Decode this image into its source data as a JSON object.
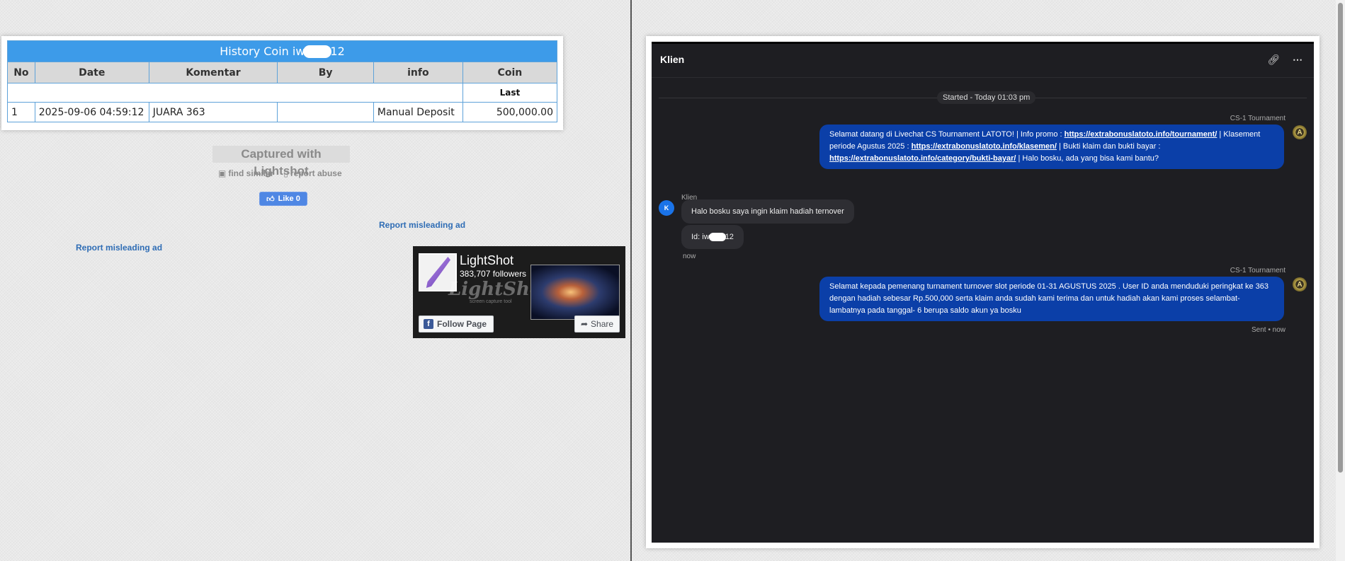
{
  "history": {
    "title_prefix": "History Coin iw",
    "title_suffix": "12",
    "columns": [
      "No",
      "Date",
      "Komentar",
      "By",
      "info",
      "Coin"
    ],
    "last_label": "Last",
    "rows": [
      {
        "no": "1",
        "date": "2025-09-06 04:59:12",
        "komentar": "JUARA 363",
        "by": "",
        "info": "Manual Deposit",
        "coin": "500,000.00"
      }
    ]
  },
  "lightshot": {
    "caption": "Captured with Lightshot",
    "find_similar": "find similar",
    "report_abuse": "report abuse",
    "like_label": "Like 0",
    "report_ad_1": "Report misleading ad",
    "report_ad_2": "Report misleading ad"
  },
  "fb_widget": {
    "name": "LightShot",
    "followers": "383,707 followers",
    "brand": "LightShot",
    "tagline": "screen capture tool",
    "follow_label": "Follow Page",
    "share_label": "Share"
  },
  "chat": {
    "title": "Klien",
    "started": "Started - Today 01:03 pm",
    "agent_name_1": "CS-1 Tournament",
    "agent_msg_1": {
      "t1": "Selamat datang di Livechat CS Tournament LATOTO! | Info promo : ",
      "link1": "https://extrabonuslatoto.info/tournament/",
      "t2": " | Klasement periode Agustus 2025 : ",
      "link2": "https://extrabonuslatoto.info/klasemen/",
      "t3": " | Bukti klaim dan bukti bayar : ",
      "link3": "https://extrabonuslatoto.info/category/bukti-bayar/",
      "t4": " | Halo bosku, ada yang bisa kami bantu?"
    },
    "client_name": "Klien",
    "client_initial": "K",
    "client_msg_1": "Halo bosku saya ingin klaim hadiah ternover",
    "client_msg_2_prefix": "Id: iw",
    "client_msg_2_suffix": "12",
    "client_time": "now",
    "agent_name_2": "CS-1 Tournament",
    "agent_msg_2": "Selamat kepada pemenang turnament turnover slot periode 01-31 AGUSTUS 2025 . User ID anda menduduki peringkat ke 363 dengan hadiah sebesar Rp.500,000 serta klaim anda sudah kami terima dan untuk hadiah akan kami proses selambat-lambatnya pada tanggal- 6 berupa saldo akun ya bosku",
    "sent_status": "Sent • now"
  },
  "icons": {
    "link": "link-icon",
    "more": "more-icon",
    "camera": "camera-icon",
    "trash": "trash-icon",
    "thumbs_up": "thumbs-up-icon"
  }
}
